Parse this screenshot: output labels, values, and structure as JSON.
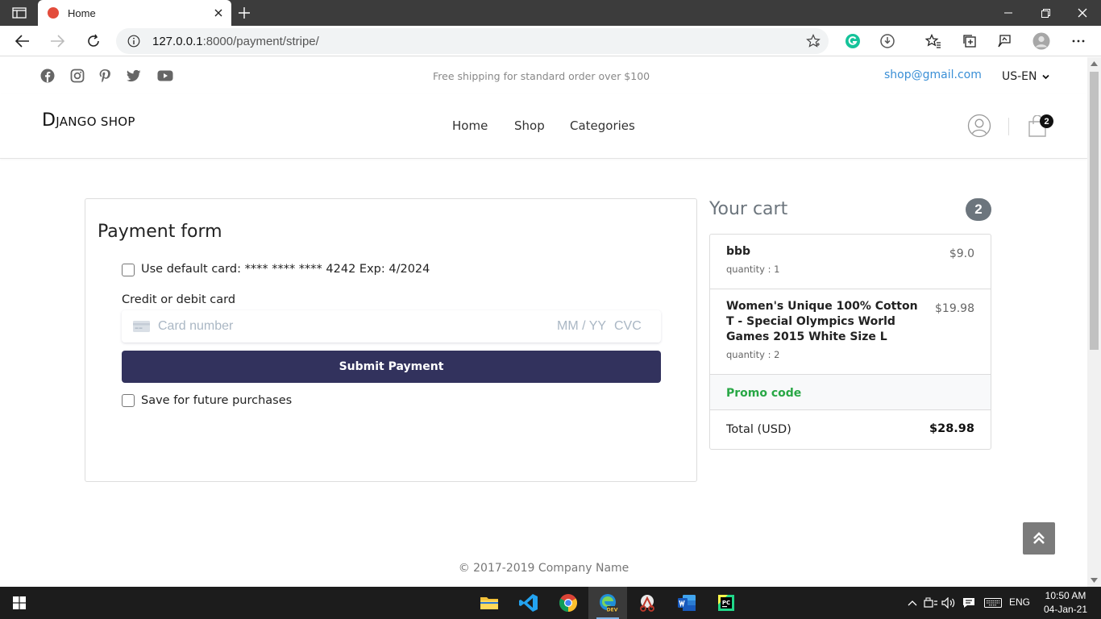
{
  "browser": {
    "tab_title": "Home",
    "url_host": "127.0.0.1",
    "url_rest": ":8000/payment/stripe/"
  },
  "topbar": {
    "shipping_notice": "Free shipping for standard order over $100",
    "email": "shop@gmail.com",
    "language": "US-EN",
    "social_icons": [
      "facebook-icon",
      "instagram-icon",
      "pinterest-icon",
      "twitter-icon",
      "youtube-icon"
    ]
  },
  "header": {
    "logo_first": "D",
    "logo_rest": "JANGO SHOP",
    "nav": [
      "Home",
      "Shop",
      "Categories"
    ],
    "cart_count": "2"
  },
  "payment": {
    "title": "Payment form",
    "default_card_label": "Use default card: **** **** **** 4242 Exp: 4/2024",
    "card_label": "Credit or debit card",
    "card_number_placeholder": "Card number",
    "exp_placeholder": "MM / YY",
    "cvc_placeholder": "CVC",
    "submit_label": "Submit Payment",
    "save_label": "Save for future purchases"
  },
  "cart": {
    "heading": "Your cart",
    "badge": "2",
    "items": [
      {
        "name": "bbb",
        "quantity": "quantity : 1",
        "price": "$9.0"
      },
      {
        "name": "Women's Unique 100% Cotton T - Special Olympics World Games 2015 White Size L",
        "quantity": "quantity : 2",
        "price": "$19.98"
      }
    ],
    "promo_label": "Promo code",
    "total_label": "Total (USD)",
    "total_value": "$28.98"
  },
  "footer": {
    "copyright": "© 2017-2019 Company Name"
  },
  "taskbar": {
    "lang": "ENG",
    "time": "10:50 AM",
    "date": "04-Jan-21"
  },
  "colors": {
    "submit_button": "#32325d",
    "email_link": "#3a8fd6",
    "promo": "#28a745",
    "badge": "#6c757d"
  }
}
